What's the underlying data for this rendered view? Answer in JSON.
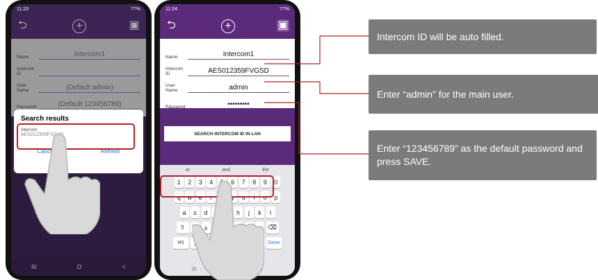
{
  "phone1": {
    "status_time": "11:23",
    "status_right": "77%",
    "form": {
      "name_label": "Name",
      "name_value": "Intercom1",
      "id_label": "Intercom ID",
      "id_value": "",
      "user_label": "User Name",
      "user_value": "(Default admin)",
      "pass_label": "Password",
      "pass_value": "(Default 123456789)"
    },
    "dialog": {
      "title": "Search results",
      "item_label": "Intercom",
      "item_value": "AES012359FVGSD",
      "cancel": "Cancel",
      "refresh": "Refresh"
    },
    "nav": [
      "III",
      "O",
      "<"
    ]
  },
  "phone2": {
    "status_time": "11:24",
    "status_right": "77%",
    "form": {
      "name_label": "Name",
      "name_value": "Intercom1",
      "id_label": "Intercom ID",
      "id_value": "AES012359FVGSD",
      "user_label": "User Name",
      "user_value": "admin",
      "pass_label": "Password",
      "pass_value": "•••••••••"
    },
    "search_button": "SEARCH INTERCOM ID IN LAN",
    "suggestions": [
      "or",
      "and",
      "the"
    ],
    "keyboard": {
      "numbers": [
        "1",
        "2",
        "3",
        "4",
        "5",
        "6",
        "7",
        "8",
        "9",
        "0"
      ],
      "row1": [
        "q",
        "w",
        "e",
        "r",
        "t",
        "y",
        "u",
        "i",
        "o",
        "p"
      ],
      "row2": [
        "a",
        "s",
        "d",
        "f",
        "g",
        "h",
        "j",
        "k",
        "l"
      ],
      "row3": [
        "z",
        "x",
        "c",
        "v",
        "b",
        "n",
        "m"
      ],
      "sym": "!#1",
      "comma": ",",
      "period": ".",
      "done": "Done"
    },
    "nav": [
      "III",
      "v"
    ]
  },
  "callouts": {
    "c1": "Intercom ID will be auto filled.",
    "c2": "Enter “admin” for the main user.",
    "c3": "Enter “123456789” as the default password and press SAVE."
  },
  "colors": {
    "appbar": "#5b2a7a",
    "callout": "#7b7b7b",
    "highlight": "#b21e24"
  },
  "icons": [
    "back-icon",
    "add-circle-icon",
    "save-icon",
    "backspace-icon",
    "shift-icon",
    "hand-pointer-icon"
  ]
}
